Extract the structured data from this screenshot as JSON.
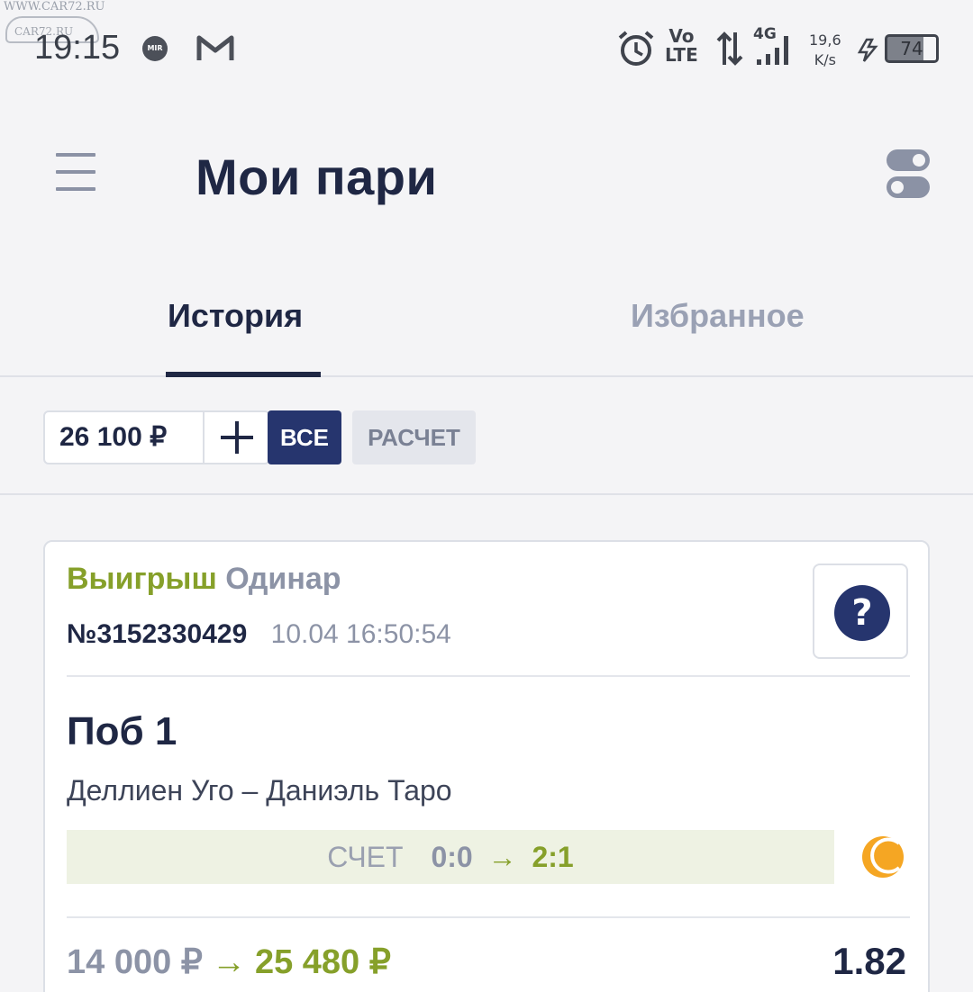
{
  "status_bar": {
    "watermark": "WWW.CAR72.RU",
    "watermark_logo": "CAR72.RU",
    "time": "19:15",
    "mir_label": "MIR",
    "volte_top": "Vo",
    "volte_bottom": "LTE",
    "network": "4G",
    "speed_value": "19,6",
    "speed_unit": "K/s",
    "battery": "74"
  },
  "header": {
    "title": "Мои пари"
  },
  "tabs": [
    {
      "label": "История",
      "active": true
    },
    {
      "label": "Избранное",
      "active": false
    }
  ],
  "filters": {
    "balance": "26 100 ₽",
    "all_label": "ВСЕ",
    "calc_label": "РАСЧЕТ"
  },
  "bet": {
    "status": "Выигрыш",
    "kind": "Одинар",
    "number": "№3152330429",
    "datetime": "10.04 16:50:54",
    "help": "?",
    "outcome": "Поб 1",
    "match": "Деллиен Уго – Даниэль Таро",
    "score_label": "СЧЕТ",
    "score_from": "0:0",
    "score_arrow": "→",
    "score_to": "2:1",
    "stake": "14 000 ₽",
    "amount_arrow": "→",
    "payout": "25 480 ₽",
    "odds": "1.82"
  },
  "colors": {
    "primary": "#26356e",
    "win": "#86a02a",
    "muted": "#8c93a6",
    "sport_icon": "#f5a623"
  },
  "icons": [
    "menu-icon",
    "settings-toggle-icon",
    "help-icon",
    "tennis-icon",
    "alarm-icon",
    "gmail-icon",
    "battery-icon"
  ]
}
